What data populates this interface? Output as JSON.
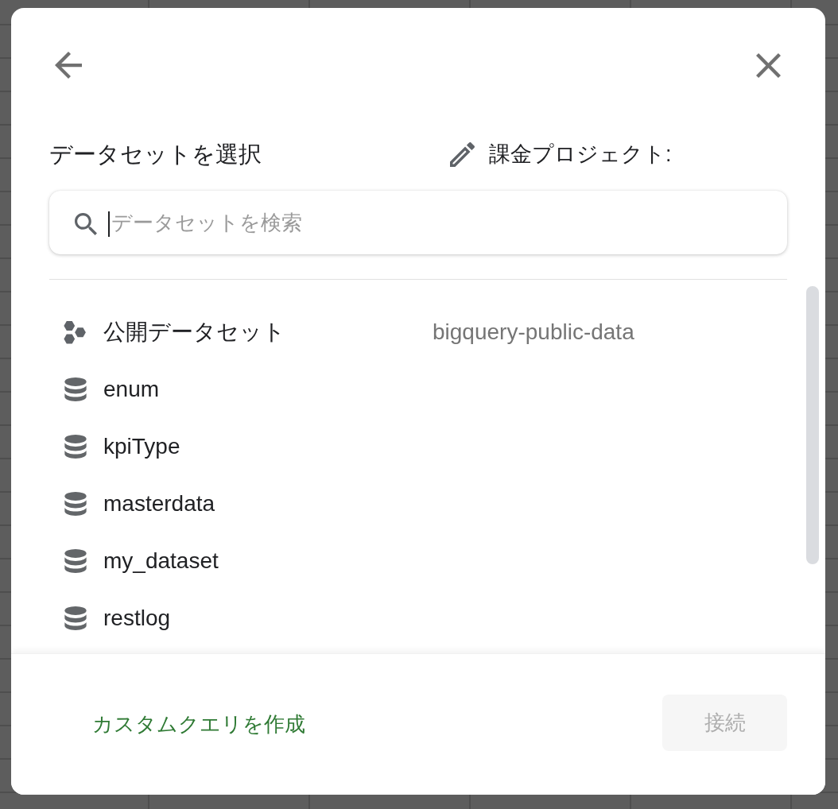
{
  "header": {
    "title": "データセットを選択",
    "billing_project": "課金プロジェクト:"
  },
  "search": {
    "placeholder": "データセットを検索",
    "focused": true
  },
  "datasets": [
    {
      "kind": "public",
      "name": "公開データセット",
      "project": "bigquery-public-data"
    },
    {
      "kind": "dataset",
      "name": "enum"
    },
    {
      "kind": "dataset",
      "name": "kpiType"
    },
    {
      "kind": "dataset",
      "name": "masterdata"
    },
    {
      "kind": "dataset",
      "name": "my_dataset"
    },
    {
      "kind": "dataset",
      "name": "restlog"
    }
  ],
  "footer": {
    "link": "カスタムクエリを作成",
    "button": {
      "label": "接続",
      "disabled": true
    }
  }
}
